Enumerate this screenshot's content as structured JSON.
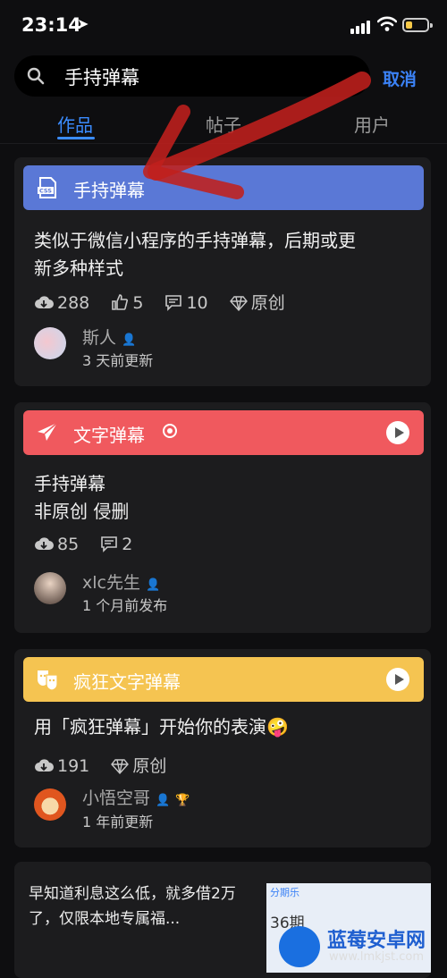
{
  "status_bar": {
    "time": "23:14",
    "location_glyph": "➤"
  },
  "search": {
    "query": "手持弹幕",
    "cancel_label": "取消"
  },
  "tabs": [
    {
      "label": "作品",
      "active": true
    },
    {
      "label": "帖子",
      "active": false
    },
    {
      "label": "用户",
      "active": false
    }
  ],
  "cards": [
    {
      "banner_title": "手持弹幕",
      "banner_color": "#5a78d6",
      "description": [
        "类似于微信小程序的手持弹幕，后期或更",
        "新多种样式"
      ],
      "downloads": "288",
      "likes": "5",
      "comments": "10",
      "tag": "原创",
      "author": "斯人",
      "updated": "3 天前更新"
    },
    {
      "banner_title": "文字弹幕",
      "banner_color": "#f0595e",
      "description": [
        "手持弹幕",
        "非原创 侵删"
      ],
      "downloads": "85",
      "comments": "2",
      "author": "xlc先生",
      "updated": "1 个月前发布"
    },
    {
      "banner_title": "疯狂文字弹幕",
      "banner_color": "#f5c451",
      "description": [
        "用「疯狂弹幕」开始你的表演🤪"
      ],
      "downloads": "191",
      "tag": "原创",
      "author": "小悟空哥",
      "updated": "1 年前更新"
    }
  ],
  "ad": {
    "text": "早知道利息这么低，就多借2万了，仅限本地专属福...",
    "img_brand": "分期乐",
    "img_value": "36期"
  },
  "watermark": {
    "name": "蓝莓安卓网",
    "url": "www.lmkjst.com"
  }
}
